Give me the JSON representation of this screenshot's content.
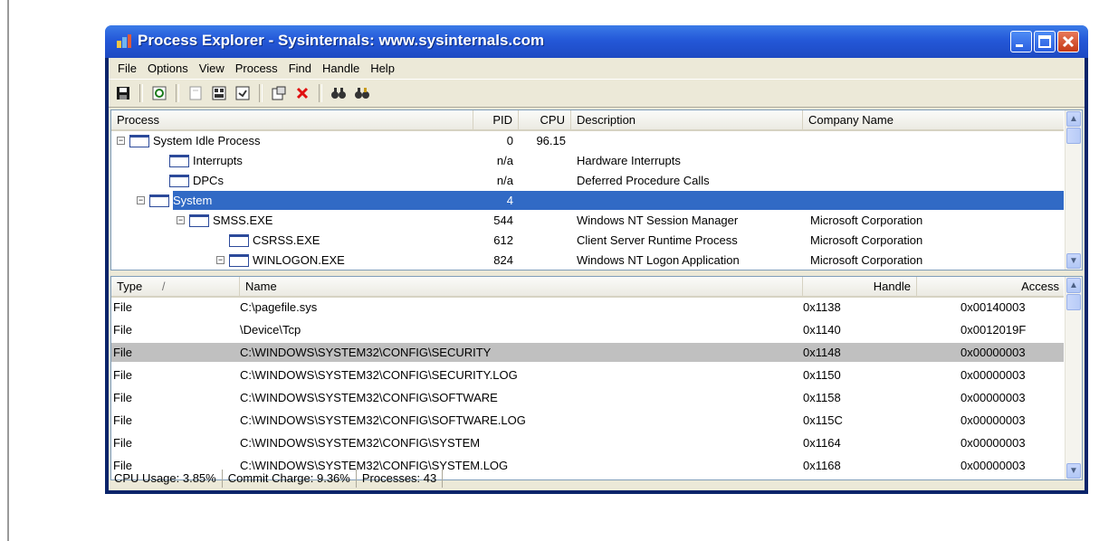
{
  "window": {
    "title": "Process Explorer - Sysinternals: www.sysinternals.com"
  },
  "menu": [
    "File",
    "Options",
    "View",
    "Process",
    "Find",
    "Handle",
    "Help"
  ],
  "toolbar": {
    "icons": [
      "save-icon",
      "refresh-icon",
      "cpu-history-icon",
      "system-info-icon",
      "dll-view-icon",
      "properties-icon",
      "kill-process-icon",
      "find-icon",
      "find-handle-icon"
    ]
  },
  "process_table": {
    "columns": [
      "Process",
      "PID",
      "CPU",
      "Description",
      "Company Name"
    ],
    "rows": [
      {
        "name": "System Idle Process",
        "pid": "0",
        "cpu": "96.15",
        "description": "",
        "company": "",
        "level": 0,
        "expander": "⊟"
      },
      {
        "name": "Interrupts",
        "pid": "n/a",
        "cpu": "",
        "description": "Hardware Interrupts",
        "company": "",
        "level": 1,
        "expander": ""
      },
      {
        "name": "DPCs",
        "pid": "n/a",
        "cpu": "",
        "description": "Deferred Procedure Calls",
        "company": "",
        "level": 1,
        "expander": ""
      },
      {
        "name": "System",
        "pid": "4",
        "cpu": "",
        "description": "",
        "company": "",
        "level": 0.5,
        "expander": "⊟",
        "selected": true
      },
      {
        "name": "SMSS.EXE",
        "pid": "544",
        "cpu": "",
        "description": "Windows NT Session Manager",
        "company": "Microsoft Corporation",
        "level": 1.5,
        "expander": "⊟"
      },
      {
        "name": "CSRSS.EXE",
        "pid": "612",
        "cpu": "",
        "description": "Client Server Runtime Process",
        "company": "Microsoft Corporation",
        "level": 2.5,
        "expander": ""
      },
      {
        "name": "WINLOGON.EXE",
        "pid": "824",
        "cpu": "",
        "description": "Windows NT Logon Application",
        "company": "Microsoft Corporation",
        "level": 2.5,
        "expander": "⊟"
      }
    ]
  },
  "handle_table": {
    "columns": [
      "Type",
      "Name",
      "Handle",
      "Access"
    ],
    "sort_indicator": "/",
    "rows": [
      {
        "type": "File",
        "name": "C:\\pagefile.sys",
        "handle": "0x1138",
        "access": "0x00140003"
      },
      {
        "type": "File",
        "name": "\\Device\\Tcp",
        "handle": "0x1140",
        "access": "0x0012019F"
      },
      {
        "type": "File",
        "name": "C:\\WINDOWS\\SYSTEM32\\CONFIG\\SECURITY",
        "handle": "0x1148",
        "access": "0x00000003",
        "highlighted": true
      },
      {
        "type": "File",
        "name": "C:\\WINDOWS\\SYSTEM32\\CONFIG\\SECURITY.LOG",
        "handle": "0x1150",
        "access": "0x00000003"
      },
      {
        "type": "File",
        "name": "C:\\WINDOWS\\SYSTEM32\\CONFIG\\SOFTWARE",
        "handle": "0x1158",
        "access": "0x00000003"
      },
      {
        "type": "File",
        "name": "C:\\WINDOWS\\SYSTEM32\\CONFIG\\SOFTWARE.LOG",
        "handle": "0x115C",
        "access": "0x00000003"
      },
      {
        "type": "File",
        "name": "C:\\WINDOWS\\SYSTEM32\\CONFIG\\SYSTEM",
        "handle": "0x1164",
        "access": "0x00000003"
      },
      {
        "type": "File",
        "name": "C:\\WINDOWS\\SYSTEM32\\CONFIG\\SYSTEM.LOG",
        "handle": "0x1168",
        "access": "0x00000003"
      }
    ]
  },
  "status": {
    "cpu": "CPU Usage: 3.85%",
    "commit": "Commit Charge: 9.36%",
    "processes": "Processes: 43"
  },
  "colors": {
    "selection": "#316ac5",
    "titlebar": "#2458d8",
    "highlight_row": "#c0c0c0"
  }
}
